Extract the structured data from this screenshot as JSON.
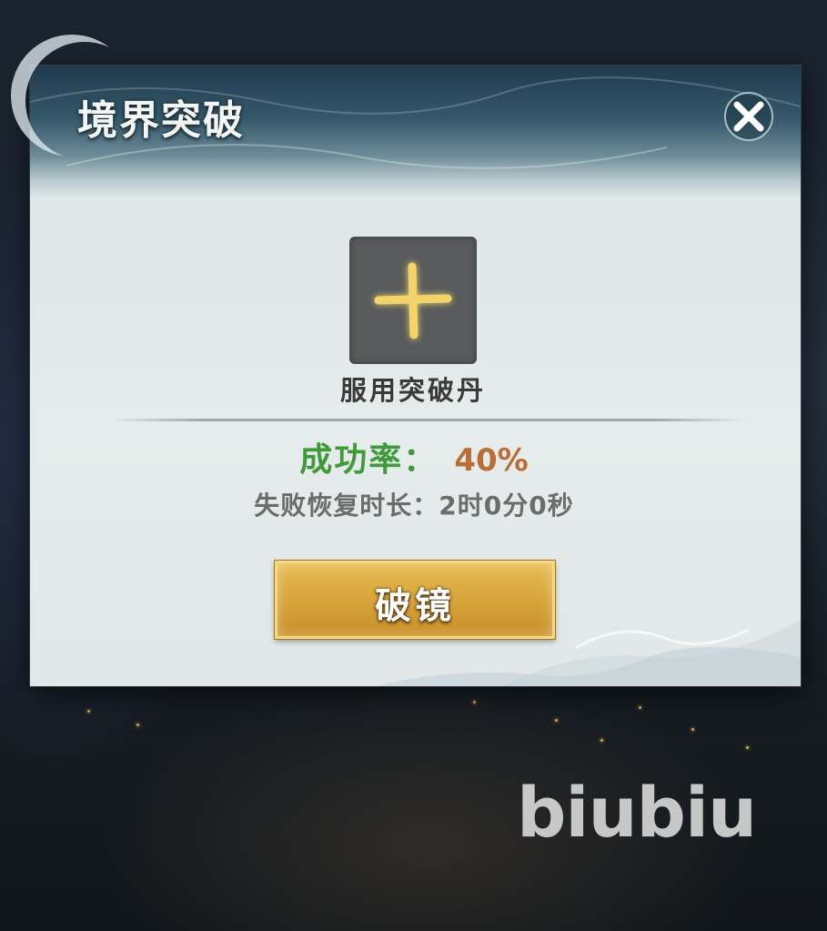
{
  "dialog": {
    "title": "境界突破",
    "close_icon": "close-icon",
    "slot": {
      "icon": "add-plus-icon",
      "label": "服用突破丹"
    },
    "success_rate": {
      "label": "成功率：",
      "value": "40%"
    },
    "recovery": {
      "text": "失败恢复时长：2时0分0秒"
    },
    "break_button": {
      "label": "破镜"
    }
  },
  "watermark": {
    "text": "biubiu"
  },
  "colors": {
    "success_label": "#3f9a3a",
    "success_value": "#b96e35",
    "button_gold": "#d9a73d",
    "plus_glow": "#f3d46a"
  }
}
